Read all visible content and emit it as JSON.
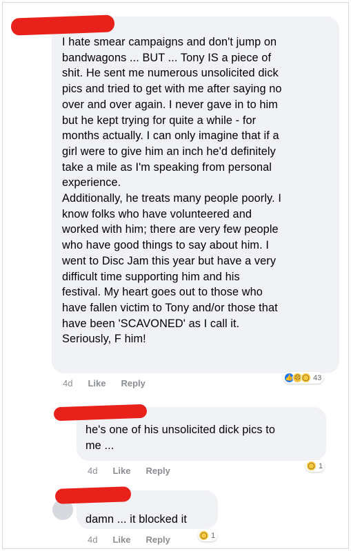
{
  "comments": [
    {
      "text": "I hate smear campaigns and don't jump on\nbandwagons ... BUT ... Tony IS a piece of\nshit.  He sent me numerous unsolicited dick\npics and tried to get with me after saying no\nover and over again. I never gave in to him\nbut he kept trying for quite a while - for\nmonths actually. I can only imagine that if a\ngirl were to give him an inch he'd definitely\ntake a mile as I'm speaking from personal\nexperience.\nAdditionally, he treats many people poorly.  I\nknow folks who have volunteered and\nworked with him; there are very few people\nwho have good things to say about him.  I\nwent to Disc Jam this year but have a very\ndifficult time supporting him and his\nfestival. My heart goes out to those who\nhave fallen victim to Tony and/or those that\nhave been 'SCAVONED' as I call it.\nSeriously, F him!",
      "time": "4d",
      "like": "Like",
      "reply": "Reply",
      "reaction_count": "43",
      "reaction_icons": [
        "like-reaction-icon",
        "sad-reaction-icon",
        "wow-reaction-icon"
      ]
    },
    {
      "text": "he's one of his unsolicited dick pics to\nme ...",
      "time": "4d",
      "like": "Like",
      "reply": "Reply",
      "reaction_count": "1",
      "reaction_icons": [
        "wow-reaction-icon"
      ]
    },
    {
      "text": "damn ... it blocked it",
      "time": "4d",
      "like": "Like",
      "reply": "Reply",
      "reaction_count": "1",
      "reaction_icons": [
        "wow-reaction-icon"
      ]
    }
  ],
  "colors": {
    "bubble": "#f0f2f5",
    "redaction": "#e8221b",
    "meta_text": "#8a8d91",
    "like_reaction": "#1877f2",
    "wow_reaction": "#f7c843"
  }
}
